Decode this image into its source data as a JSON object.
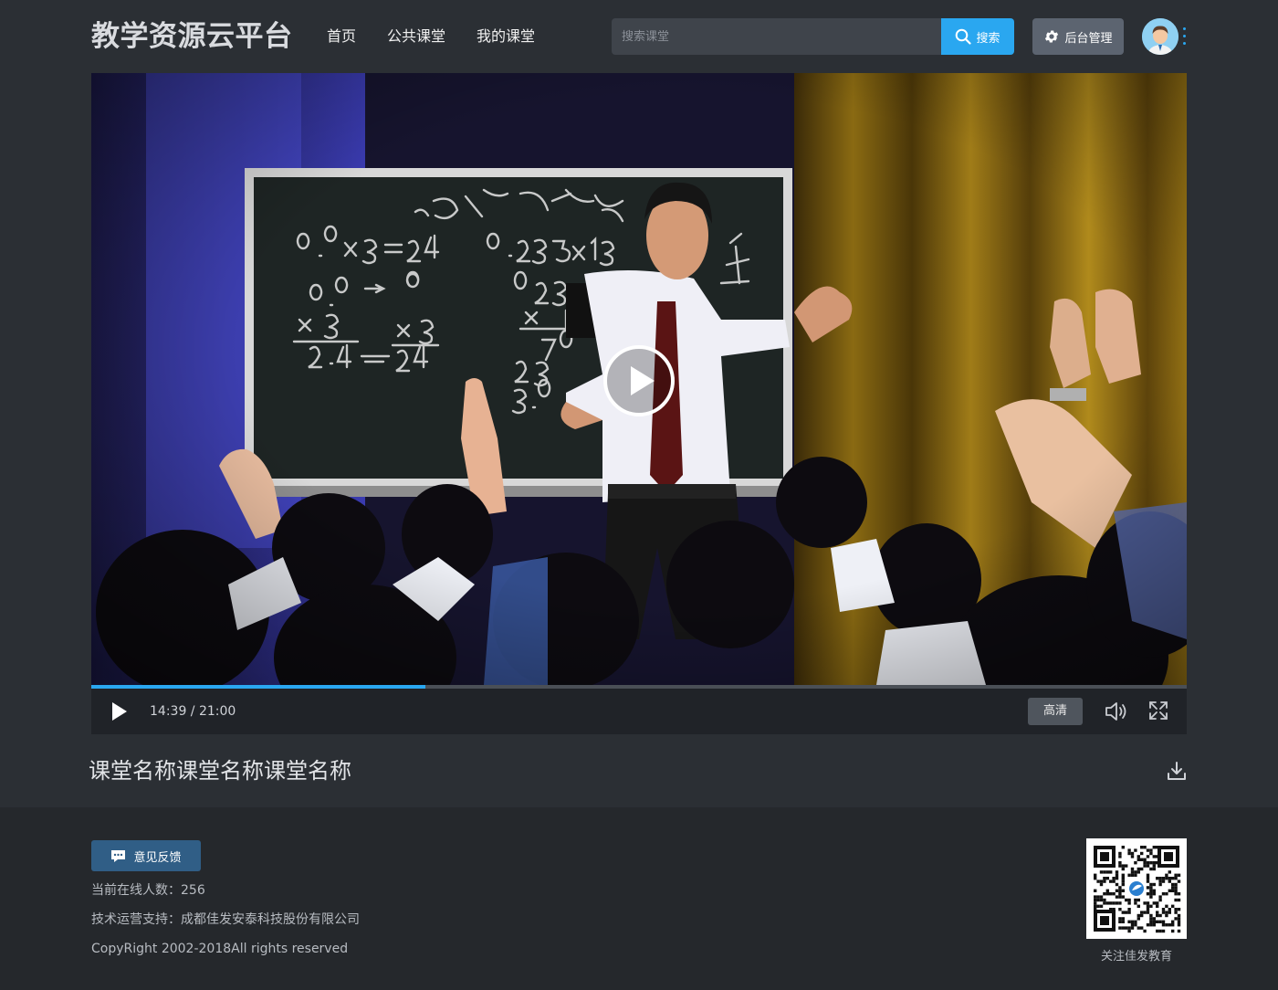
{
  "header": {
    "logo": "教学资源云平台",
    "nav": [
      {
        "label": "首页"
      },
      {
        "label": "公共课堂"
      },
      {
        "label": "我的课堂"
      }
    ],
    "search_placeholder": "搜索课堂",
    "search_button": "搜索",
    "admin_button": "后台管理"
  },
  "player": {
    "time": "14:39 / 21:00",
    "progress": 0.3048,
    "quality_button": "高清"
  },
  "lesson": {
    "title": "课堂名称课堂名称课堂名称"
  },
  "footer": {
    "feedback_button": "意见反馈",
    "online_users": "当前在线人数：256",
    "support": "技术运营支持：成都佳发安泰科技股份有限公司",
    "copyright": "CopyRight 2002-2018All rights reserved",
    "qr_caption": "关注佳发教育"
  },
  "colors": {
    "accent": "#2aa7f0",
    "page_bg": "#2b2f34",
    "footer_bg": "#25282c",
    "feedback_bg": "#305e86"
  }
}
